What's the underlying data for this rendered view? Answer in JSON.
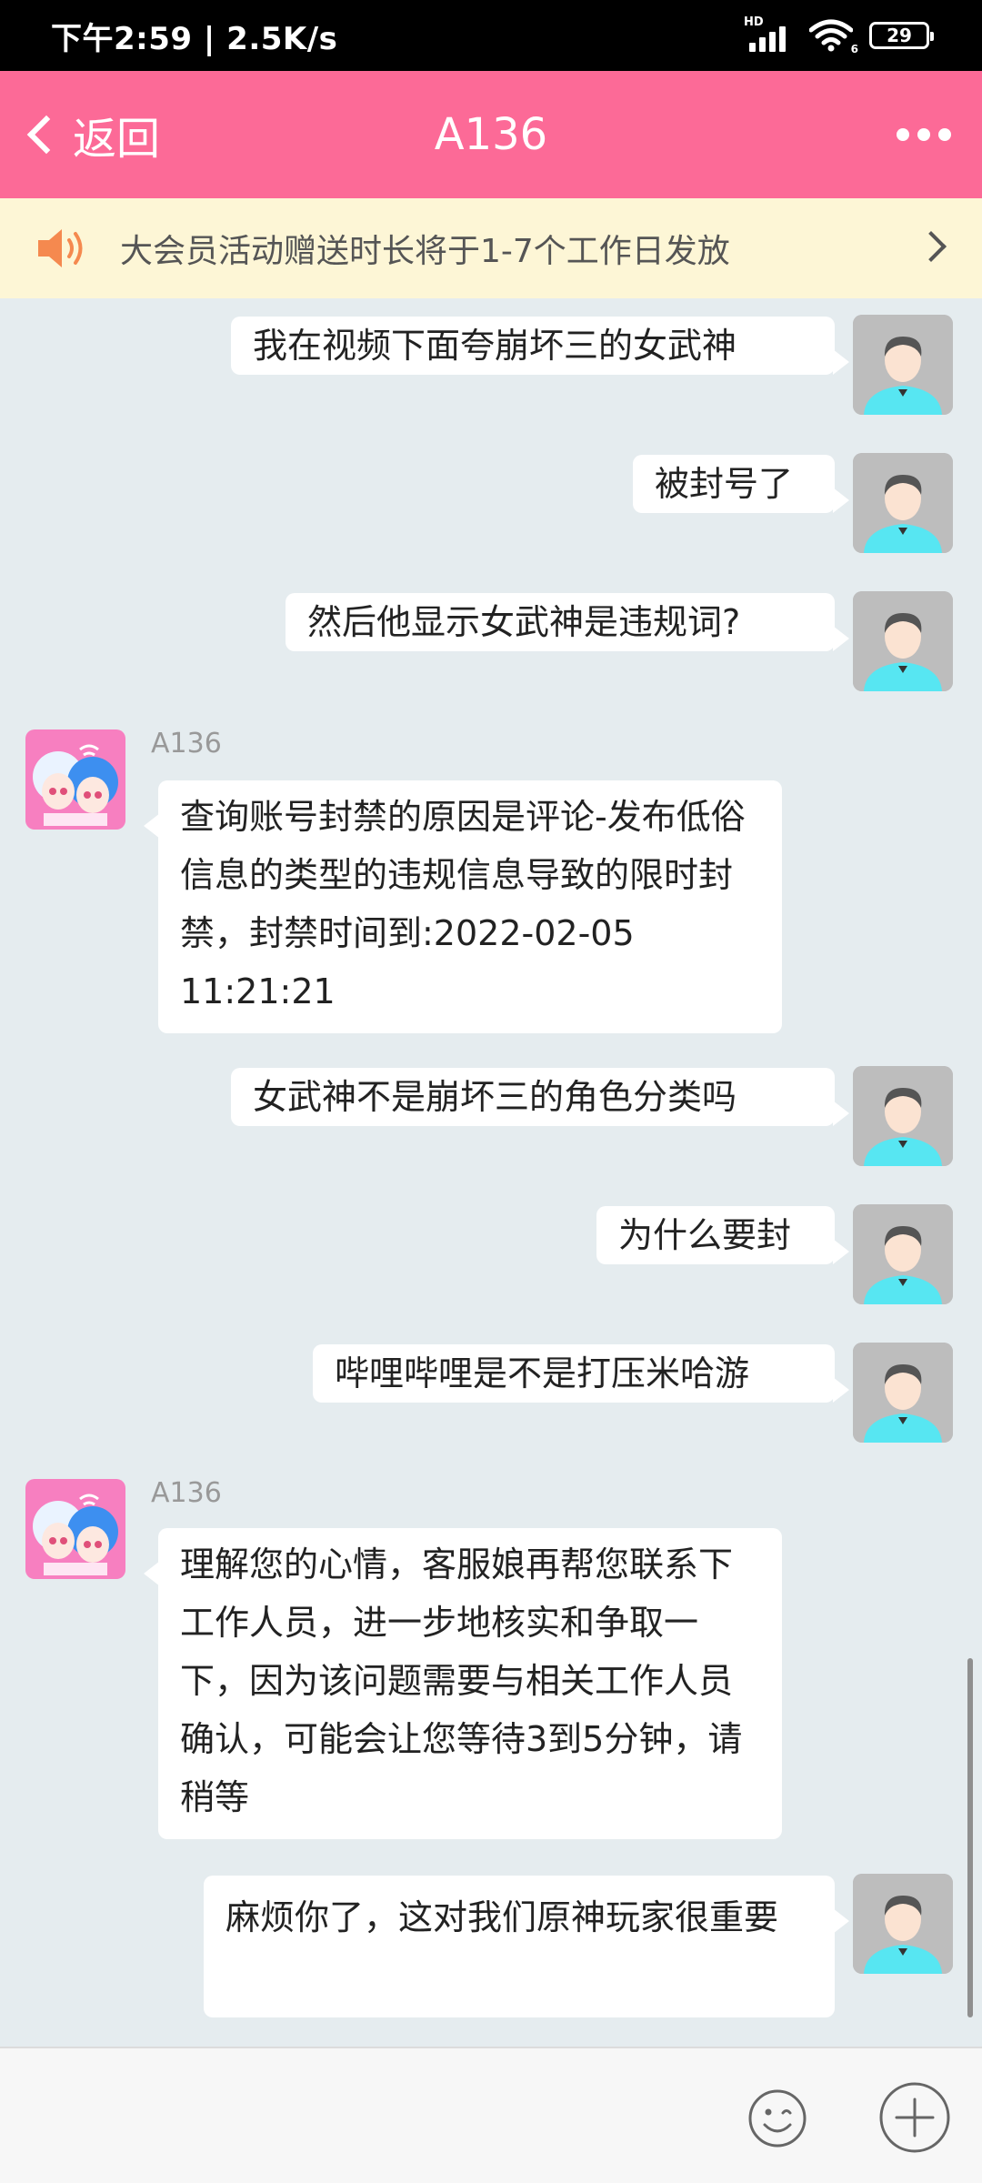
{
  "status_bar": {
    "time_speed": "下午2:59 | 2.5K/s",
    "hd_label": "HD",
    "wifi_badge": "6",
    "battery": "29"
  },
  "header": {
    "back_label": "返回",
    "title": "A136"
  },
  "notice": {
    "text": "大会员活动赠送时长将于1-7个工作日发放"
  },
  "messages": [
    {
      "from": "user",
      "text": "我在视频下面夸崩坏三的女武神"
    },
    {
      "from": "user",
      "text": "被封号了"
    },
    {
      "from": "user",
      "text": "然后他显示女武神是违规词?"
    },
    {
      "from": "agent",
      "sender": "A136",
      "text": "查询账号封禁的原因是评论-发布低俗信息的类型的违规信息导致的限时封禁，封禁时间到:2022-02-05 11:21:21"
    },
    {
      "from": "user",
      "text": "女武神不是崩坏三的角色分类吗"
    },
    {
      "from": "user",
      "text": "为什么要封"
    },
    {
      "from": "user",
      "text": "哔哩哔哩是不是打压米哈游"
    },
    {
      "from": "agent",
      "sender": "A136",
      "text": "理解您的心情，客服娘再帮您联系下工作人员，进一步地核实和争取一下，因为该问题需要与相关工作人员确认，可能会让您等待3到5分钟，请稍等"
    },
    {
      "from": "user",
      "text": "麻烦你了，这对我们原神玩家很重要"
    }
  ],
  "input": {
    "placeholder": ""
  },
  "colors": {
    "header": "#fc6a97",
    "notice_bg": "#fdf6d6",
    "chat_bg": "#e5ecef",
    "avatar_shirt": "#57e6f2"
  }
}
